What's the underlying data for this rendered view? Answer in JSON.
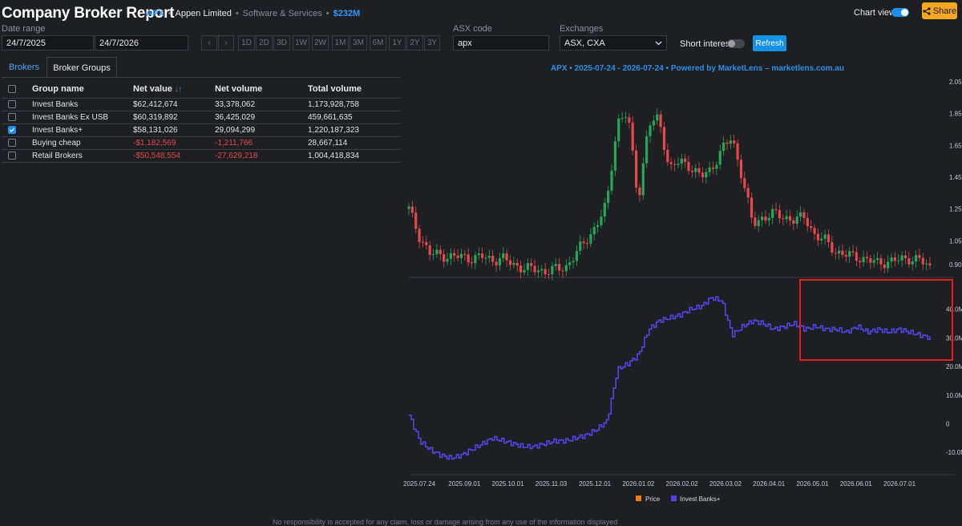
{
  "header": {
    "title": "Company Broker Report",
    "code": "APX",
    "separator": "•",
    "company": "Appen Limited",
    "sector": "Software & Services",
    "market_cap": "$232M",
    "chart_view_label": "Chart view",
    "chart_view_on": true,
    "share_label": "Share"
  },
  "controls": {
    "date_range_label": "Date range",
    "date_from": "24/7/2025",
    "date_to": "24/7/2026",
    "prev_glyph": "‹",
    "next_glyph": "›",
    "periods": [
      "1D",
      "2D",
      "3D",
      "1W",
      "2W",
      "1M",
      "3M",
      "6M",
      "1Y",
      "2Y",
      "3Y"
    ],
    "asx_code_label": "ASX code",
    "asx_code_value": "apx",
    "exchanges_label": "Exchanges",
    "exchanges_value": "ASX, CXA",
    "short_interest_label": "Short interest",
    "short_interest_on": false,
    "refresh_label": "Refresh"
  },
  "tabs": [
    {
      "label": "Brokers",
      "active": false
    },
    {
      "label": "Broker Groups",
      "active": true
    }
  ],
  "table": {
    "columns": [
      "Group name",
      "Net value",
      "Net volume",
      "Total volume"
    ],
    "sort_icon": "↓↑",
    "rows": [
      {
        "name": "Invest Banks",
        "net_value": "$62,412,674",
        "net_volume": "33,378,062",
        "total_volume": "1,173,928,758",
        "checked": false,
        "negative": false
      },
      {
        "name": "Invest Banks Ex USB",
        "net_value": "$60,319,892",
        "net_volume": "36,425,029",
        "total_volume": "459,661,635",
        "checked": false,
        "negative": false
      },
      {
        "name": "Invest Banks+",
        "net_value": "$58,131,026",
        "net_volume": "29,094,299",
        "total_volume": "1,220,187,323",
        "checked": true,
        "negative": false
      },
      {
        "name": "Buying cheap",
        "net_value": "-$1,182,569",
        "net_volume": "-1,211,766",
        "total_volume": "28,667,114",
        "checked": false,
        "negative": true
      },
      {
        "name": "Retail Brokers",
        "net_value": "-$50,548,554",
        "net_volume": "-27,629,218",
        "total_volume": "1,004,418,834",
        "checked": false,
        "negative": true
      }
    ]
  },
  "chart_data": {
    "type": "line",
    "title": "APX • 2025-07-24 - 2026-07-24 • Powered by MarketLens – marketlens.com.au",
    "x_labels": [
      "2025.09.01",
      "2025.10.01",
      "2025.11.03",
      "2025.12.01",
      "2026.01.02",
      "2026.02.02",
      "2026.03.02",
      "2026.04.01",
      "2026.05.01",
      "2026.06.01",
      "2026.07.01"
    ],
    "x_start_label": "2025.07.24",
    "price_axis": {
      "ticks": [
        "2.050",
        "1.850",
        "1.650",
        "1.450",
        "1.250",
        "1.050",
        "0.900"
      ],
      "ylim": [
        0.84,
        2.05
      ]
    },
    "volume_axis": {
      "ticks": [
        "40.0M",
        "30.0M",
        "20.0M",
        "10.0M",
        "0",
        "-10.0M"
      ],
      "ylim": [
        -15,
        50
      ]
    },
    "price_series": {
      "name": "Price",
      "type": "candlestick",
      "up_color": "#26a65b",
      "down_color": "#e5484d",
      "x": [
        0,
        0.02,
        0.04,
        0.06,
        0.08,
        0.1,
        0.12,
        0.14,
        0.16,
        0.18,
        0.2,
        0.22,
        0.24,
        0.26,
        0.28,
        0.3,
        0.32,
        0.34,
        0.36,
        0.38,
        0.4,
        0.42,
        0.44,
        0.46,
        0.48,
        0.5,
        0.52,
        0.54,
        0.56,
        0.58,
        0.6,
        0.62,
        0.64,
        0.66,
        0.68,
        0.7,
        0.72,
        0.74,
        0.76,
        0.78,
        0.8,
        0.82,
        0.84,
        0.86,
        0.88,
        0.9,
        0.92,
        0.94,
        0.96,
        0.98,
        1.0
      ],
      "close": [
        1.25,
        1.08,
        0.97,
        0.96,
        0.95,
        0.95,
        0.94,
        0.95,
        0.93,
        0.94,
        0.9,
        0.88,
        0.87,
        0.86,
        0.87,
        0.88,
        0.97,
        1.05,
        1.15,
        1.28,
        1.8,
        1.85,
        1.3,
        1.78,
        1.82,
        1.5,
        1.55,
        1.52,
        1.45,
        1.5,
        1.62,
        1.7,
        1.45,
        1.15,
        1.2,
        1.22,
        1.2,
        1.18,
        1.2,
        1.08,
        1.05,
        0.98,
        0.96,
        0.95,
        0.93,
        0.91,
        0.92,
        0.93,
        0.94,
        0.93,
        0.88
      ]
    },
    "volume_series": {
      "name": "Invest Banks+",
      "color": "#5246e8",
      "x": [
        0,
        0.02,
        0.04,
        0.06,
        0.08,
        0.1,
        0.12,
        0.14,
        0.16,
        0.18,
        0.2,
        0.22,
        0.24,
        0.26,
        0.28,
        0.3,
        0.32,
        0.34,
        0.36,
        0.38,
        0.4,
        0.42,
        0.44,
        0.46,
        0.48,
        0.5,
        0.52,
        0.54,
        0.56,
        0.58,
        0.6,
        0.62,
        0.64,
        0.66,
        0.68,
        0.7,
        0.72,
        0.74,
        0.76,
        0.78,
        0.8,
        0.82,
        0.84,
        0.86,
        0.88,
        0.9,
        0.92,
        0.94,
        0.96,
        0.98,
        1.0
      ],
      "y": [
        3,
        -6,
        -9,
        -11,
        -12,
        -11,
        -9,
        -7,
        -5,
        -6,
        -7,
        -8,
        -8,
        -7,
        -6,
        -6,
        -5,
        -4,
        -2,
        1,
        19,
        21,
        24,
        33,
        36,
        37,
        38,
        40,
        41,
        44,
        43,
        31,
        34,
        36,
        35,
        33,
        34,
        35,
        33,
        34,
        33,
        33,
        32,
        34,
        32,
        33,
        32,
        33,
        32,
        31,
        30
      ]
    },
    "legend": [
      "Price",
      "Invest Banks+"
    ],
    "legend_position": "bottom",
    "highlight_box_color": "#e02020"
  },
  "footer": "No responsibility is accepted for any claim, loss or damage arising from any use of the information displayed"
}
